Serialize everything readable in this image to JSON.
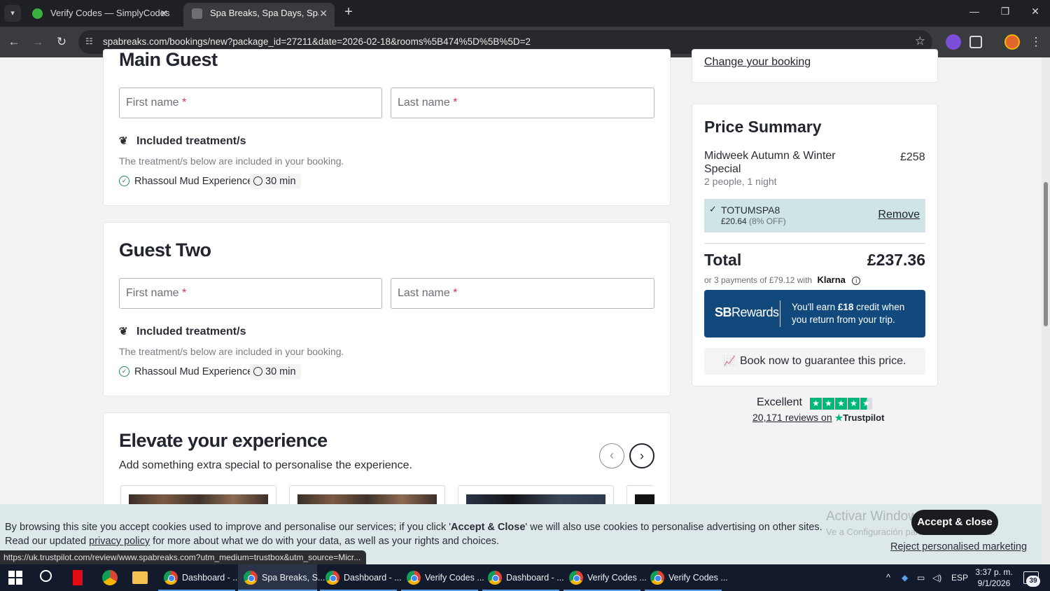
{
  "browser": {
    "tabs": [
      {
        "title": "Verify Codes — SimplyCodes",
        "active": false
      },
      {
        "title": "Spa Breaks, Spa Days, Spa Weel",
        "active": true
      }
    ],
    "url": "spabreaks.com/bookings/new?package_id=27211&date=2026-02-18&rooms%5B474%5D%5B%5D=2",
    "status_url": "https://uk.trustpilot.com/review/www.spabreaks.com?utm_medium=trustbox&utm_source=Micr..."
  },
  "main_guest": {
    "heading": "Main Guest",
    "first_name_placeholder": "First name",
    "last_name_placeholder": "Last name",
    "required_mark": "*",
    "included_title": "Included treatment/s",
    "included_note": "The treatment/s below are included in your booking.",
    "treatment": "Rhassoul Mud Experience",
    "duration": "30 min"
  },
  "guest_two": {
    "heading": "Guest Two",
    "first_name_placeholder": "First name",
    "last_name_placeholder": "Last name",
    "required_mark": "*",
    "included_title": "Included treatment/s",
    "included_note": "The treatment/s below are included in your booking.",
    "treatment": "Rhassoul Mud Experience",
    "duration": "30 min"
  },
  "elevate": {
    "heading": "Elevate your experience",
    "subtitle": "Add something extra special to personalise the experience."
  },
  "sidebar": {
    "change_booking": "Change your booking",
    "price_summary_title": "Price Summary",
    "package_name": "Midweek Autumn & Winter Special",
    "package_price": "£258",
    "package_details": "2 people, 1 night",
    "promo_code": "TOTUMSPA8",
    "promo_saving": "£20.64",
    "promo_percent": "(8% OFF)",
    "promo_remove": "Remove",
    "total_label": "Total",
    "total_value": "£237.36",
    "klarna_text": "or 3 payments of £79.12 with",
    "klarna_brand": "Klarna",
    "rewards_logo_bold": "SB",
    "rewards_logo_rest": "Rewards",
    "rewards_text_pre": "You'll earn ",
    "rewards_amount": "£18",
    "rewards_text_post": " credit when you return from your trip.",
    "book_guarantee": "Book now to guarantee this price.",
    "trustpilot_rating": "Excellent",
    "trustpilot_reviews": "20,171 reviews on",
    "trustpilot_brand": "Trustpilot"
  },
  "cookie": {
    "line1_pre": "By browsing this site you accept cookies used to improve and personalise our services; if you click '",
    "line1_bold": "Accept & Close",
    "line1_post": "' we will also use cookies to personalise advertising on other sites.",
    "line2_pre": "Read our updated ",
    "line2_link": "privacy policy",
    "line2_post": " for more about what we do with your data, as well as your rights and choices.",
    "accept": "Accept & close",
    "reject": "Reject personalised marketing"
  },
  "watermark": {
    "line1": "Activar Windows",
    "line2": "Ve a Configuración para activar Windows."
  },
  "taskbar": {
    "items": [
      "Dashboard - ...",
      "Spa Breaks, S...",
      "Dashboard - ...",
      "Verify Codes ...",
      "Dashboard - ...",
      "Verify Codes ...",
      "Verify Codes ..."
    ],
    "language": "ESP",
    "time": "3:37 p. m.",
    "date": "9/1/2026",
    "notifications": "39"
  }
}
